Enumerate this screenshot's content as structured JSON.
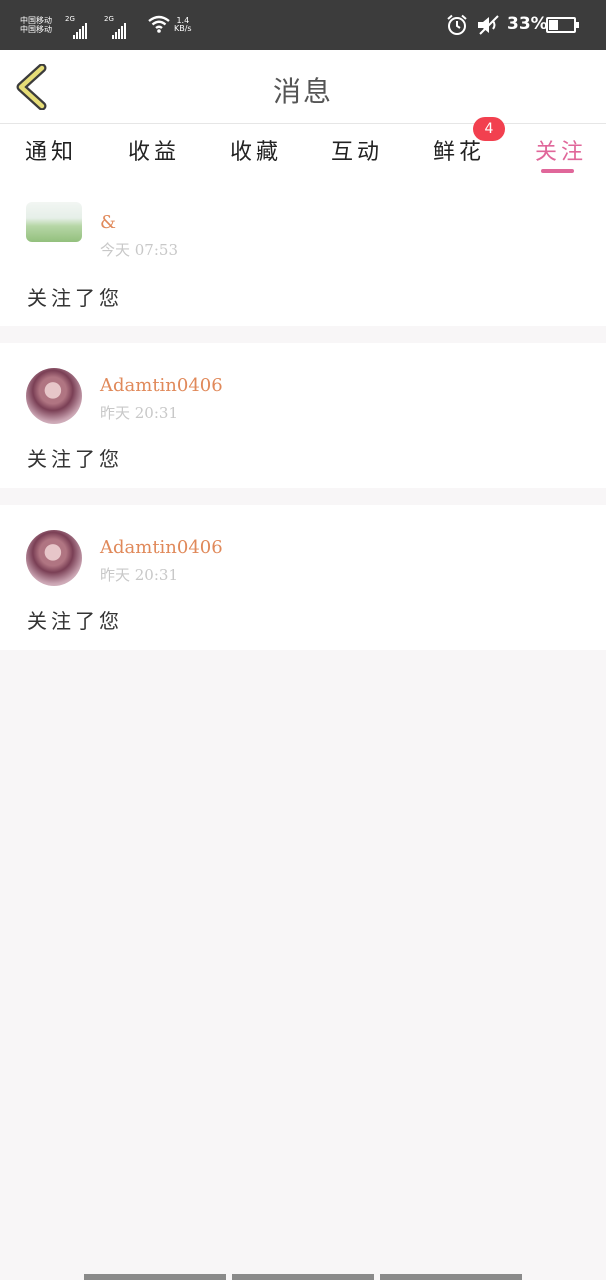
{
  "status_bar": {
    "carrier_line1": "中国移动",
    "carrier_line2": "中国移动",
    "sim1_network": "2G",
    "sim2_network": "2G",
    "speed_value": "1.4",
    "speed_unit": "KB/s",
    "battery_percent": "33%",
    "battery_level": 0.33,
    "icons": [
      "signal-icon",
      "wifi-icon",
      "alarm-icon",
      "mute-icon",
      "battery-icon"
    ]
  },
  "header": {
    "back_icon": "chevron-left-icon",
    "title": "消息"
  },
  "tabs": [
    {
      "label": "通知",
      "active": false
    },
    {
      "label": "收益",
      "active": false
    },
    {
      "label": "收藏",
      "active": false
    },
    {
      "label": "互动",
      "active": false
    },
    {
      "label": "鲜花",
      "active": false,
      "badge": "4"
    },
    {
      "label": "关注",
      "active": true
    }
  ],
  "colors": {
    "accent": "#e0679a",
    "username": "#e0895a",
    "badge": "#f2404f"
  },
  "messages": [
    {
      "username": "&",
      "time": "今天 07:53",
      "text": "关注了您",
      "avatar": "landscape-avatar"
    },
    {
      "username": "Adamtin0406",
      "time": "昨天 20:31",
      "text": "关注了您",
      "avatar": "portrait-avatar"
    },
    {
      "username": "Adamtin0406",
      "time": "昨天 20:31",
      "text": "关注了您",
      "avatar": "portrait-avatar"
    }
  ]
}
